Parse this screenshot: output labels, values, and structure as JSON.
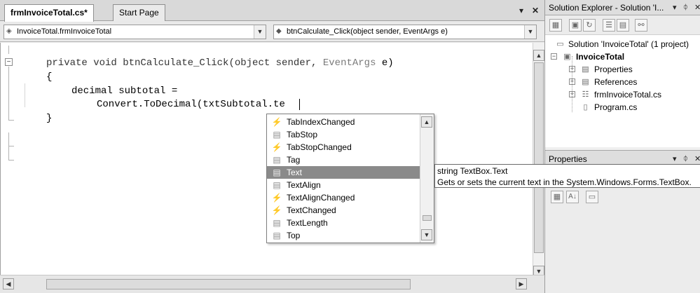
{
  "tabs": [
    {
      "label": "frmInvoiceTotal.cs*",
      "active": true
    },
    {
      "label": "Start Page",
      "active": false
    }
  ],
  "tab_controls": {
    "dropdown_glyph": "▾",
    "close_glyph": "✕"
  },
  "navbar": {
    "class_combo": "InvoiceTotal.frmInvoiceTotal",
    "member_combo": "btnCalculate_Click(object sender, EventArgs e)"
  },
  "code": {
    "line1": {
      "a": "private void btnCalculate_Click(object sender, ",
      "b": "EventArgs",
      "c": " e)"
    },
    "line2": "{",
    "line3": "decimal subtotal =",
    "line4": "Convert.ToDecimal(txtSubtotal.te",
    "line5": "}"
  },
  "completion": {
    "items": [
      {
        "label": "TabIndexChanged",
        "icon": "event-icon",
        "glyph": "⚡"
      },
      {
        "label": "TabStop",
        "icon": "property-icon",
        "glyph": "▤"
      },
      {
        "label": "TabStopChanged",
        "icon": "event-icon",
        "glyph": "⚡"
      },
      {
        "label": "Tag",
        "icon": "property-icon",
        "glyph": "▤"
      },
      {
        "label": "Text",
        "icon": "property-icon",
        "glyph": "▤",
        "selected": true
      },
      {
        "label": "TextAlign",
        "icon": "property-icon",
        "glyph": "▤"
      },
      {
        "label": "TextAlignChanged",
        "icon": "event-icon",
        "glyph": "⚡"
      },
      {
        "label": "TextChanged",
        "icon": "event-icon",
        "glyph": "⚡"
      },
      {
        "label": "TextLength",
        "icon": "property-icon",
        "glyph": "▤"
      },
      {
        "label": "Top",
        "icon": "property-icon",
        "glyph": "▤"
      }
    ]
  },
  "tooltip": {
    "line1": "string TextBox.Text",
    "line2": "Gets or sets the current text in the System.Windows.Forms.TextBox."
  },
  "solution_explorer": {
    "title": "Solution Explorer - Solution 'I...",
    "nodes": [
      {
        "label": "Solution 'InvoiceTotal' (1 project)",
        "icon": "solution-icon"
      },
      {
        "label": "InvoiceTotal",
        "icon": "csharp-project-icon",
        "bold": true
      },
      {
        "label": "Properties",
        "icon": "properties-folder-icon"
      },
      {
        "label": "References",
        "icon": "references-folder-icon"
      },
      {
        "label": "frmInvoiceTotal.cs",
        "icon": "form-file-icon"
      },
      {
        "label": "Program.cs",
        "icon": "csharp-file-icon"
      }
    ]
  },
  "properties_panel": {
    "title": "Properties"
  },
  "colors": {
    "selection": "#8a8a8a",
    "editor_bg": "#ffffff",
    "panel_bg": "#f0f0f0"
  }
}
